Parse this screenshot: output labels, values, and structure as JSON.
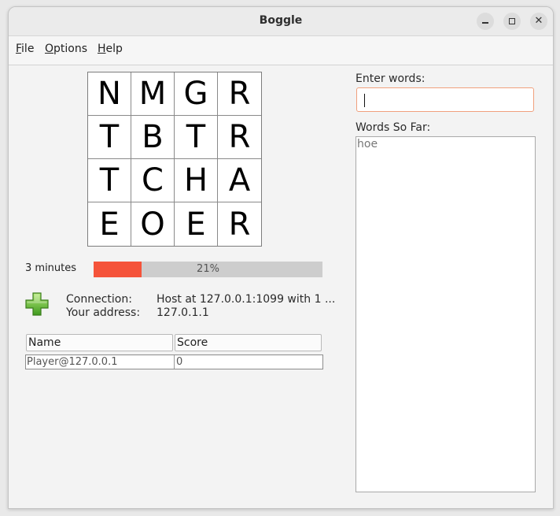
{
  "window": {
    "title": "Boggle"
  },
  "menu": [
    {
      "mnemonic": "F",
      "rest": "ile"
    },
    {
      "mnemonic": "O",
      "rest": "ptions"
    },
    {
      "mnemonic": "H",
      "rest": "elp"
    }
  ],
  "board": [
    [
      "N",
      "M",
      "G",
      "R"
    ],
    [
      "T",
      "B",
      "T",
      "R"
    ],
    [
      "T",
      "C",
      "H",
      "A"
    ],
    [
      "E",
      "O",
      "E",
      "R"
    ]
  ],
  "timer": {
    "label": "3 minutes",
    "progress_percent": 21,
    "progress_text": "21%",
    "fill_color": "#f5533a"
  },
  "connection": {
    "icon": "green-plus-icon",
    "connection_label": "Connection:",
    "connection_value": "Host at 127.0.0.1:1099 with 1 ...",
    "address_label": "Your address:",
    "address_value": "127.0.1.1"
  },
  "scores": {
    "headers": [
      "Name",
      "Score"
    ],
    "rows": [
      {
        "name": "Player@127.0.0.1",
        "score": "0"
      }
    ]
  },
  "input": {
    "label": "Enter words:",
    "value": ""
  },
  "words": {
    "label": "Words So Far:",
    "items": [
      "hoe"
    ]
  }
}
